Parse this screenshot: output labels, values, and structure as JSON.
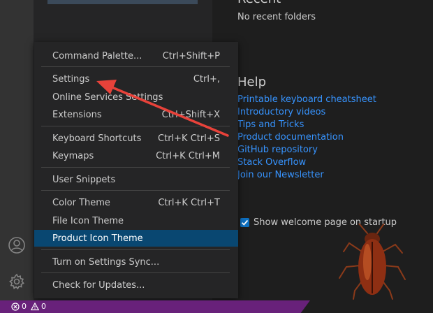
{
  "welcome": {
    "recent_title": "Recent",
    "recent_empty": "No recent folders",
    "help_title": "Help",
    "help_links": [
      "Printable keyboard cheatsheet",
      "Introductory videos",
      "Tips and Tricks",
      "Product documentation",
      "GitHub repository",
      "Stack Overflow",
      "Join our Newsletter"
    ],
    "startup_checkbox_label": "Show welcome page on startup",
    "startup_checked": true
  },
  "menu": {
    "items": [
      {
        "label": "Command Palette...",
        "shortcut": "Ctrl+Shift+P"
      },
      {
        "label": "Settings",
        "shortcut": "Ctrl+,"
      },
      {
        "label": "Online Services Settings",
        "shortcut": ""
      },
      {
        "label": "Extensions",
        "shortcut": "Ctrl+Shift+X"
      },
      {
        "label": "Keyboard Shortcuts",
        "shortcut": "Ctrl+K Ctrl+S"
      },
      {
        "label": "Keymaps",
        "shortcut": "Ctrl+K Ctrl+M"
      },
      {
        "label": "User Snippets",
        "shortcut": ""
      },
      {
        "label": "Color Theme",
        "shortcut": "Ctrl+K Ctrl+T"
      },
      {
        "label": "File Icon Theme",
        "shortcut": ""
      },
      {
        "label": "Product Icon Theme",
        "shortcut": ""
      },
      {
        "label": "Turn on Settings Sync...",
        "shortcut": ""
      },
      {
        "label": "Check for Updates...",
        "shortcut": ""
      }
    ],
    "highlighted": "Product Icon Theme"
  },
  "activity_bar": {
    "icons": [
      "account-icon",
      "gear-icon"
    ]
  },
  "status_bar": {
    "errors": "0",
    "warnings": "0"
  },
  "colors": {
    "link": "#3794ff",
    "menu_highlight": "#094771",
    "status_bar": "#68217a",
    "annotation_arrow": "#e8423a"
  }
}
